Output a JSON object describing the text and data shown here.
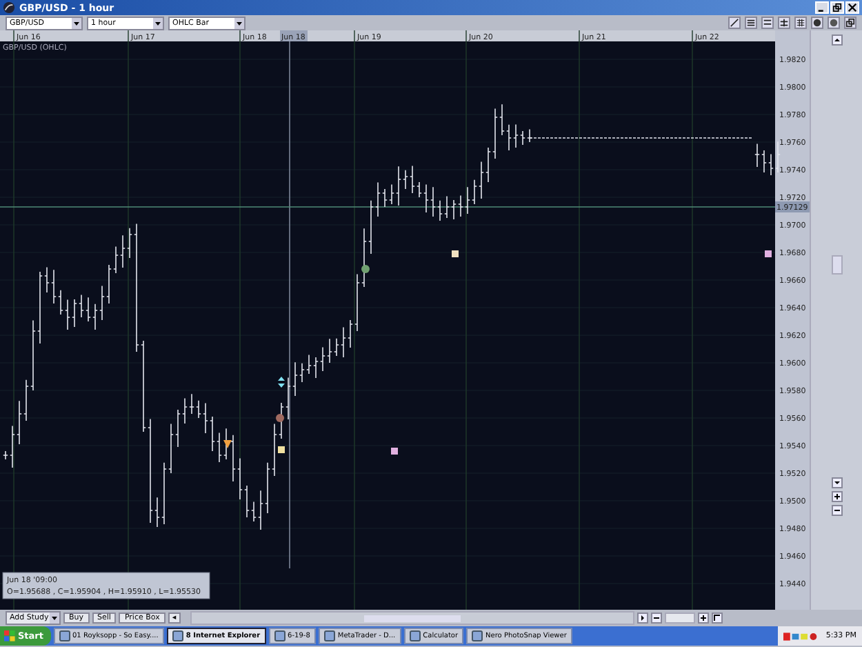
{
  "window": {
    "title": "GBP/USD - 1 hour"
  },
  "toolbar": {
    "dropdowns": [
      {
        "value": "GBP/USD"
      },
      {
        "value": "1 hour"
      },
      {
        "value": "OHLC Bar"
      }
    ]
  },
  "chart": {
    "legend": "GBP/USD (OHLC)",
    "price_tag": "1.97129",
    "crosshair_label": "Jun 18",
    "time_axis": [
      "Jun 16",
      "Jun 17",
      "Jun 18",
      "Jun 19",
      "Jun 20",
      "Jun 21",
      "Jun 22"
    ],
    "price_axis": [
      "1.9820",
      "1.9800",
      "1.9780",
      "1.9760",
      "1.9740",
      "1.9720",
      "1.9700",
      "1.9680",
      "1.9660",
      "1.9640",
      "1.9620",
      "1.9600",
      "1.9580",
      "1.9560",
      "1.9540",
      "1.9520",
      "1.9500",
      "1.9480",
      "1.9460",
      "1.9440"
    ],
    "info": {
      "time": "Jun 18 '09:00",
      "values": "O=1.95688 , C=1.95904 , H=1.95910 , L=1.95530"
    }
  },
  "bottom_toolbar": {
    "items": [
      {
        "kind": "dropdown",
        "label": "Add Study"
      },
      {
        "kind": "button",
        "label": "Buy"
      },
      {
        "kind": "button",
        "label": "Sell"
      },
      {
        "kind": "button",
        "label": "Price Box"
      },
      {
        "kind": "arrow",
        "label": "◂"
      }
    ]
  },
  "taskbar": {
    "start": "Start",
    "items": [
      {
        "label": "01 Royksopp - So Easy....",
        "selected": false
      },
      {
        "label": "8 Internet Explorer",
        "selected": true
      },
      {
        "label": "6-19-8",
        "selected": false
      },
      {
        "label": "MetaTrader - D...",
        "selected": false
      },
      {
        "label": "Calculator",
        "selected": false
      },
      {
        "label": "Nero PhotoSnap Viewer",
        "selected": false
      }
    ],
    "clock": "5:33 PM"
  }
}
